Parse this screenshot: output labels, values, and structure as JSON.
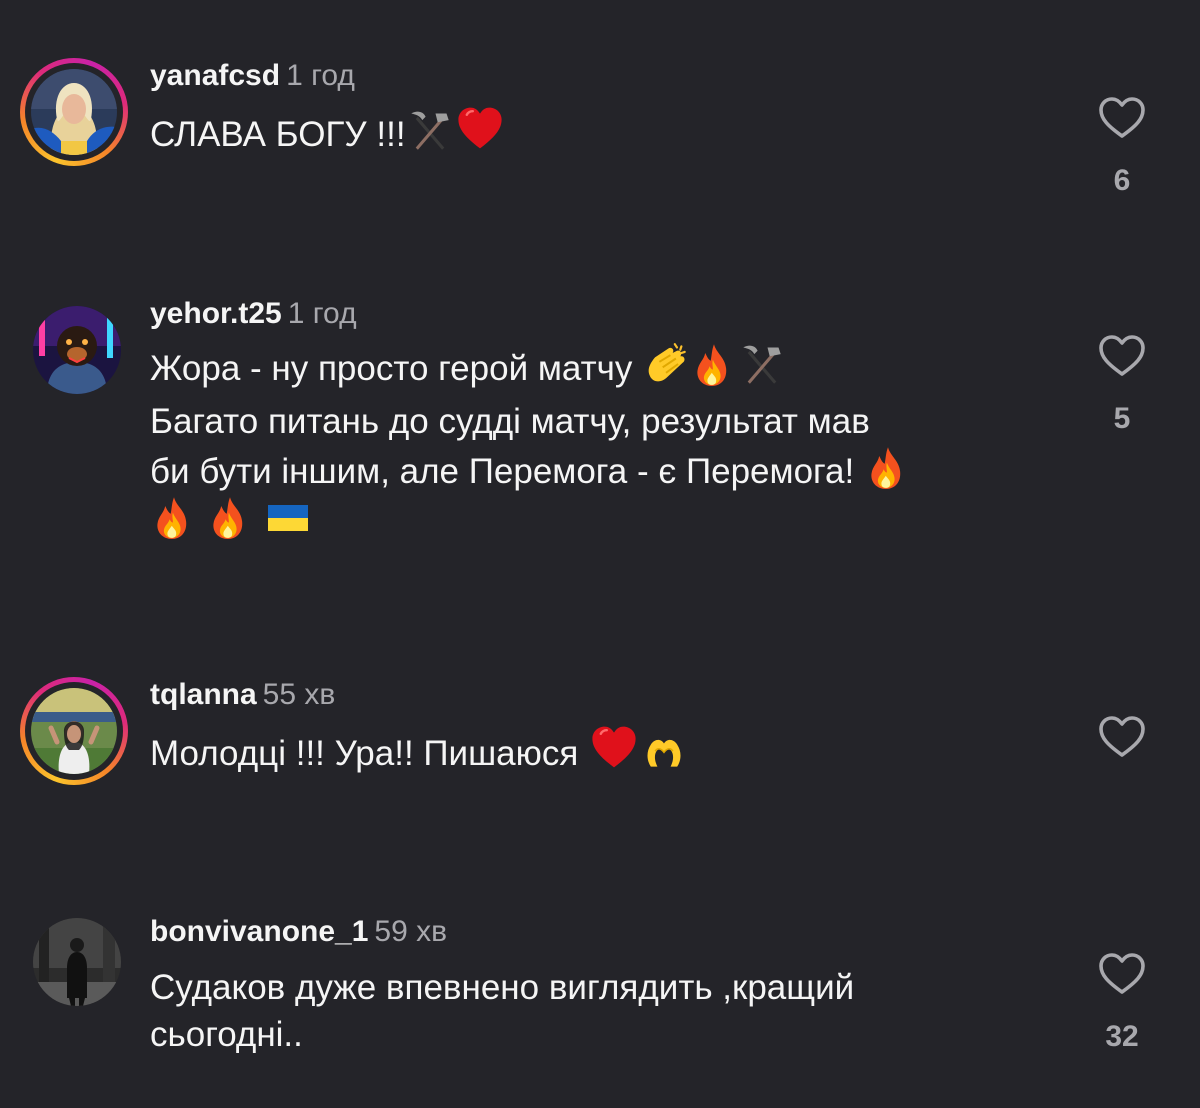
{
  "comments": [
    {
      "username": "yanafcsd",
      "time": "1 год",
      "text": "СЛАВА БОГУ !!!",
      "likes": "6",
      "has_story_ring": true
    },
    {
      "username": "yehor.t25",
      "time": "1 год",
      "text_line1": "Жора - ну просто герой матчу",
      "text_line2": "Багато питань до судді матчу, результат мав",
      "text_line3": "би бути іншим, але Перемога - є Перемога!",
      "likes": "5",
      "has_story_ring": false
    },
    {
      "username": "tqlanna",
      "time": "55 хв",
      "text": "Молодці !!! Ура!! Пишаюся",
      "likes": "",
      "has_story_ring": true
    },
    {
      "username": "bonvivanone_1",
      "time": "59 хв",
      "text_line1": "Судаков дуже впевнено виглядить ,кращий",
      "text_line2": "сьогодні..",
      "likes": "32",
      "has_story_ring": false
    }
  ],
  "colors": {
    "background": "#242429",
    "text": "#f5f5f5",
    "muted": "#a8a8ad",
    "ring_start": "#fbc32c",
    "ring_end": "#c922a8"
  },
  "icons": [
    "heart-outline-icon",
    "hammer-pick-emoji",
    "red-heart-emoji",
    "clapping-hands-emoji",
    "fire-emoji",
    "ukraine-flag-emoji",
    "heart-hands-emoji"
  ]
}
